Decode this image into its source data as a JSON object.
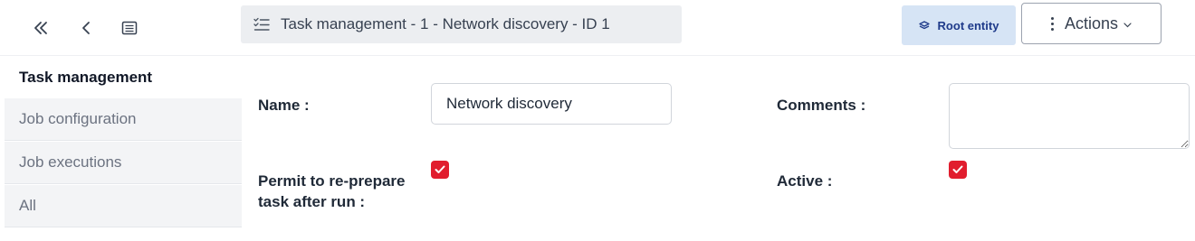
{
  "toolbar": {
    "title": "Task management - 1 - Network discovery - ID 1",
    "title_icon": "list-check-icon",
    "root_entity_label": "Root entity",
    "actions_label": "Actions",
    "nav_icons": [
      "double-chevron-left-icon",
      "chevron-left-icon",
      "list-icon"
    ]
  },
  "sidebar": {
    "tabs": [
      {
        "label": "Task management",
        "active": true
      },
      {
        "label": "Job configuration",
        "active": false
      },
      {
        "label": "Job executions",
        "active": false
      },
      {
        "label": "All",
        "active": false
      }
    ]
  },
  "form": {
    "name_label": "Name :",
    "name_value": "Network discovery",
    "comments_label": "Comments :",
    "comments_value": "",
    "permit_label": "Permit to re-prepare task after run :",
    "permit_checked": true,
    "active_label": "Active :",
    "active_checked": true
  },
  "colors": {
    "accent_red": "#e11d2e",
    "root_entity_bg": "#d6e4f5",
    "title_bg": "#eceef1"
  }
}
